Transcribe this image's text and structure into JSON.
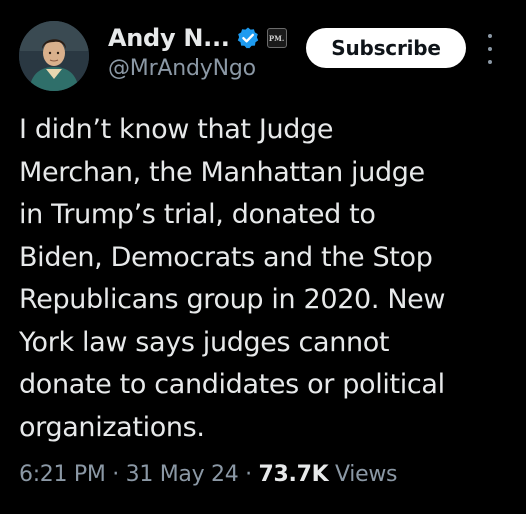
{
  "author": {
    "display_name": "Andy N...",
    "handle": "@MrAndyNgo",
    "affiliate_badge": "PM.",
    "verified_icon": "verified-badge-icon",
    "verified_color": "#1d9bf0"
  },
  "actions": {
    "subscribe_label": "Subscribe",
    "more_icon": "more-vertical-icon"
  },
  "tweet": {
    "lines": [
      "I didn’t know that Judge",
      "Merchan, the Manhattan judge",
      "in Trump’s trial, donated to",
      "Biden, Democrats and the Stop",
      "Republicans group in 2020. New",
      "York law says judges cannot",
      "donate to candidates or political",
      "organizations."
    ]
  },
  "meta": {
    "time": "6:21 PM",
    "separator": " · ",
    "date": "31 May 24",
    "views_count": "73.7K",
    "views_label": " Views"
  },
  "colors": {
    "background": "#000000",
    "text": "#e7e9ea",
    "muted": "#8b98a5",
    "button_bg": "#ffffff",
    "button_text": "#0f1419"
  }
}
